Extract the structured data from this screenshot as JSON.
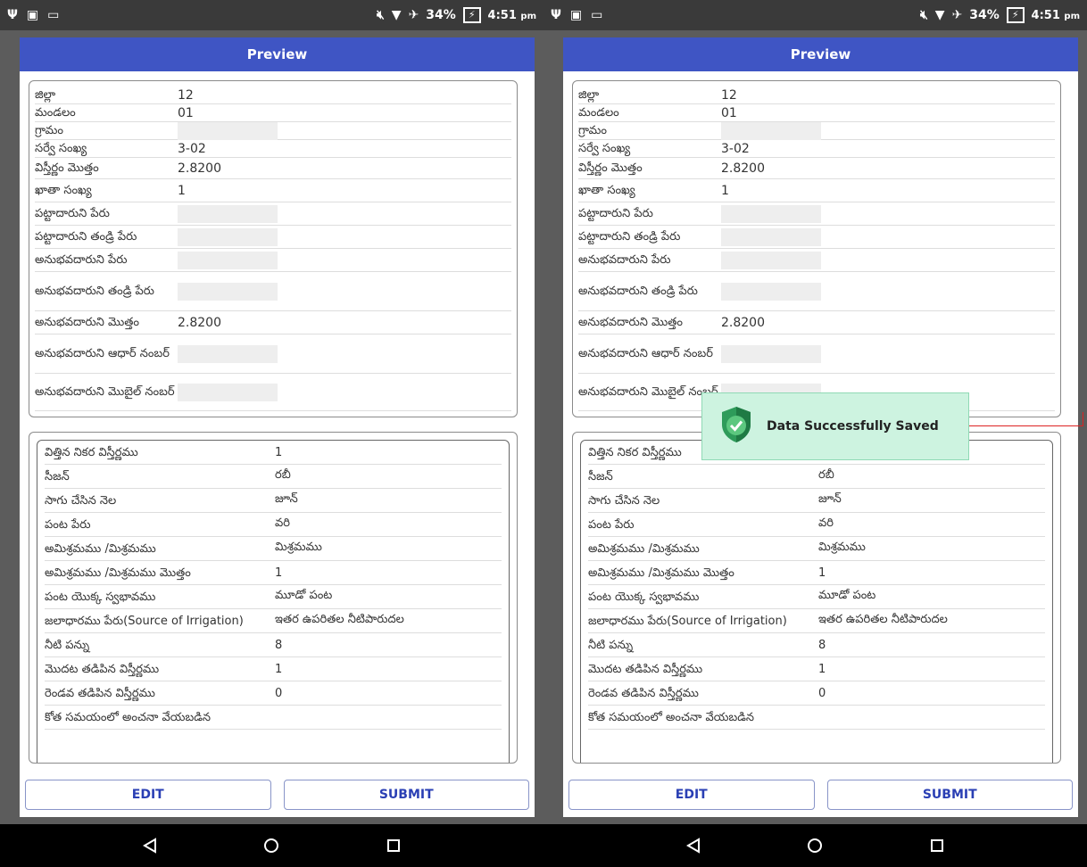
{
  "status": {
    "battery": "34%",
    "time": "4:51",
    "ampm": "pm"
  },
  "dialog": {
    "title": "Preview",
    "edit_label": "EDIT",
    "submit_label": "SUBMIT"
  },
  "land_details": [
    {
      "label": "జిల్లా",
      "value": "12"
    },
    {
      "label": "మండలం",
      "value": "01"
    },
    {
      "label": "గ్రామం",
      "value": ""
    },
    {
      "label": "సర్వే సంఖ్య",
      "value": "3-02"
    },
    {
      "label": "విస్తీర్ణం మొత్తం",
      "value": "2.8200"
    },
    {
      "label": "ఖాతా సంఖ్య",
      "value": "1"
    },
    {
      "label": "పట్టాదారుని పేరు",
      "value": ""
    },
    {
      "label": "పట్టాదారుని తండ్రి పేరు",
      "value": ""
    },
    {
      "label": "అనుభవదారుని పేరు",
      "value": ""
    },
    {
      "label": "అనుభవదారుని తండ్రి పేరు",
      "value": ""
    },
    {
      "label": "అనుభవదారుని మొత్తం",
      "value": "2.8200"
    },
    {
      "label": "అనుభవదారుని ఆధార్ నంబర్",
      "value": ""
    },
    {
      "label": "అనుభవదారుని మొబైల్ నంబర్",
      "value": ""
    }
  ],
  "crop_details": [
    {
      "label": "విత్తిన నికర విస్తీర్ణము",
      "value": "1"
    },
    {
      "label": "సీజన్",
      "value": "రబీ"
    },
    {
      "label": "సాగు చేసిన నెల",
      "value": "జూన్"
    },
    {
      "label": "పంట పేరు",
      "value": "వరి"
    },
    {
      "label": "అమిశ్రమము /మిశ్రమము",
      "value": "మిశ్రమము"
    },
    {
      "label": "అమిశ్రమము /మిశ్రమము మొత్తం",
      "value": "1"
    },
    {
      "label": "పంట యొక్క స్వభావము",
      "value": "మూడో పంట"
    },
    {
      "label": "జలాధారము పేరు(Source of Irrigation)",
      "value": "ఇతర ఉపరితల నీటిపారుదల"
    },
    {
      "label": "నీటి పన్ను",
      "value": "8"
    },
    {
      "label": "మొదట తడిపిన విస్తీర్ణము",
      "value": "1"
    },
    {
      "label": "రెండవ తడిపిన విస్తీర్ణము",
      "value": "0"
    },
    {
      "label": "కోత సమయంలో అంచనా వేయబడిన",
      "value": ""
    }
  ],
  "toast": {
    "message": "Data Successfully Saved"
  },
  "colors": {
    "title_bar": "#3f55c4",
    "toast_bg": "#cdf3e0",
    "shield": "#2e9b5a"
  }
}
